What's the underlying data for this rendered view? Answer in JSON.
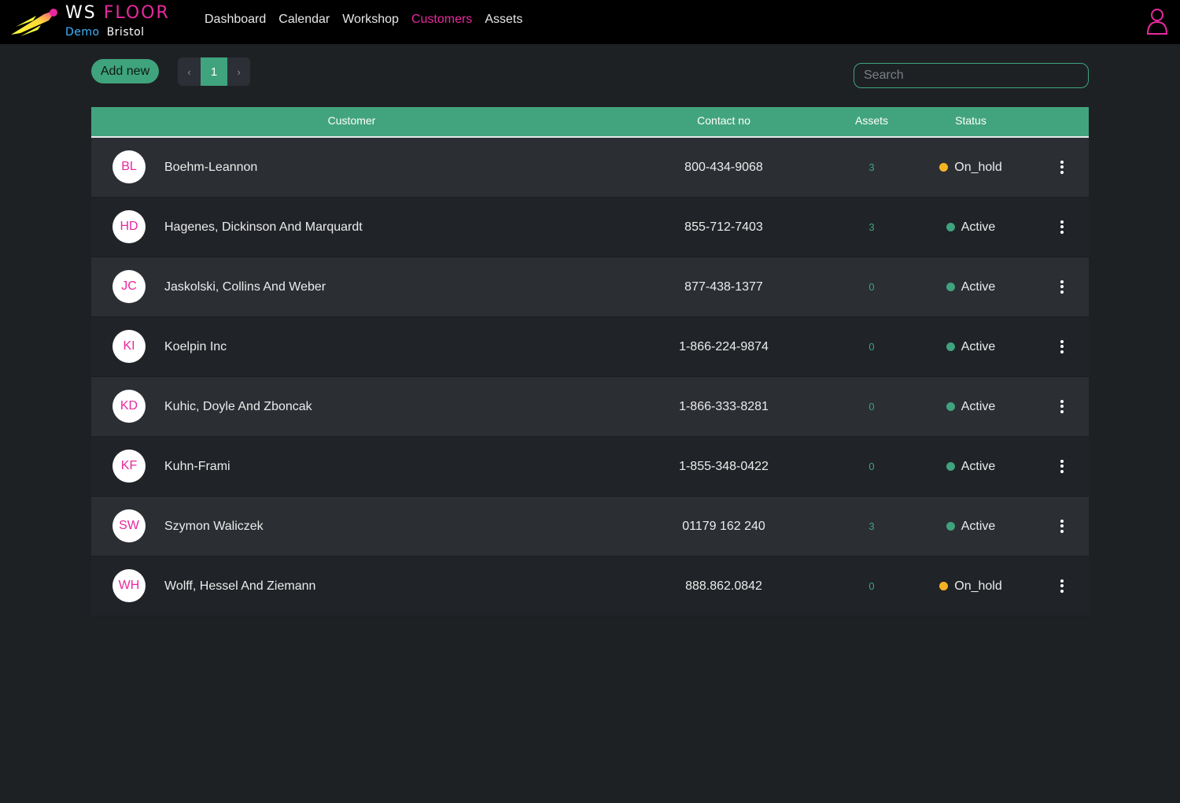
{
  "brand": {
    "ws": "WS",
    "floor": "FLOOR",
    "demo": "Demo",
    "location": "Bristol"
  },
  "nav": [
    {
      "label": "Dashboard",
      "active": false
    },
    {
      "label": "Calendar",
      "active": false
    },
    {
      "label": "Workshop",
      "active": false
    },
    {
      "label": "Customers",
      "active": true
    },
    {
      "label": "Assets",
      "active": false
    }
  ],
  "toolbar": {
    "add_label": "Add new",
    "pager": {
      "prev": "‹",
      "current": "1",
      "next": "›"
    },
    "search_placeholder": "Search"
  },
  "table": {
    "headers": {
      "customer": "Customer",
      "contact": "Contact no",
      "assets": "Assets",
      "status": "Status"
    },
    "rows": [
      {
        "initials": "BL",
        "name": "Boehm-Leannon",
        "contact": "800-434-9068",
        "assets": "3",
        "status": "On_hold"
      },
      {
        "initials": "HD",
        "name": "Hagenes, Dickinson And Marquardt",
        "contact": "855-712-7403",
        "assets": "3",
        "status": "Active"
      },
      {
        "initials": "JC",
        "name": "Jaskolski, Collins And Weber",
        "contact": "877-438-1377",
        "assets": "0",
        "status": "Active"
      },
      {
        "initials": "KI",
        "name": "Koelpin Inc",
        "contact": "1-866-224-9874",
        "assets": "0",
        "status": "Active"
      },
      {
        "initials": "KD",
        "name": "Kuhic, Doyle And Zboncak",
        "contact": "1-866-333-8281",
        "assets": "0",
        "status": "Active"
      },
      {
        "initials": "KF",
        "name": "Kuhn-Frami",
        "contact": "1-855-348-0422",
        "assets": "0",
        "status": "Active"
      },
      {
        "initials": "SW",
        "name": "Szymon Waliczek",
        "contact": "01179 162 240",
        "assets": "3",
        "status": "Active"
      },
      {
        "initials": "WH",
        "name": "Wolff, Hessel And Ziemann",
        "contact": "888.862.0842",
        "assets": "0",
        "status": "On_hold"
      }
    ]
  },
  "colors": {
    "accent": "#3fa37d",
    "brand_pink": "#e8289e",
    "status_active": "#3fa37d",
    "status_on_hold": "#f5b324"
  },
  "icons": {
    "logo": "comet-logo-icon",
    "user": "user-icon",
    "row_menu": "kebab-menu-icon"
  }
}
